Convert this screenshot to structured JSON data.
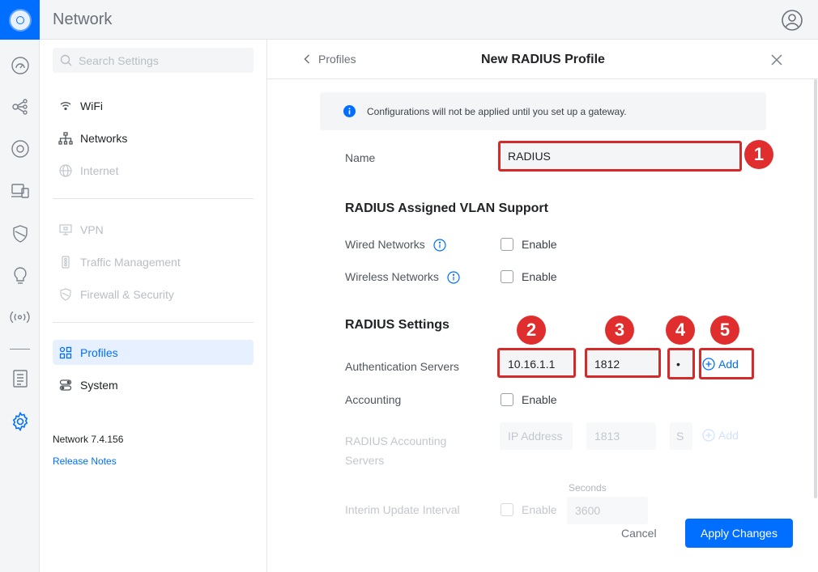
{
  "app": {
    "title": "Network"
  },
  "sidebar": {
    "search_placeholder": "Search Settings",
    "group1": [
      {
        "label": "WiFi",
        "icon": "wifi-icon",
        "enabled": true
      },
      {
        "label": "Networks",
        "icon": "network-tree-icon",
        "enabled": true
      },
      {
        "label": "Internet",
        "icon": "globe-icon",
        "enabled": false
      }
    ],
    "group2": [
      {
        "label": "VPN",
        "icon": "vpn-icon",
        "enabled": false
      },
      {
        "label": "Traffic Management",
        "icon": "traffic-icon",
        "enabled": false
      },
      {
        "label": "Firewall & Security",
        "icon": "shield-icon",
        "enabled": false
      }
    ],
    "group3": [
      {
        "label": "Profiles",
        "icon": "profiles-icon",
        "active": true
      },
      {
        "label": "System",
        "icon": "system-icon",
        "enabled": true
      }
    ],
    "version": "Network 7.4.156",
    "release_notes": "Release Notes"
  },
  "panel": {
    "back_label": "Profiles",
    "title": "New RADIUS Profile",
    "notice": "Configurations will not be applied until you set up a gateway.",
    "name_label": "Name",
    "name_value": "RADIUS",
    "vlan_section": "RADIUS Assigned VLAN Support",
    "wired_label": "Wired Networks",
    "wireless_label": "Wireless Networks",
    "enable_label": "Enable",
    "radius_section": "RADIUS Settings",
    "auth_label": "Authentication Servers",
    "auth_ip": "10.16.1.1",
    "auth_port": "1812",
    "auth_secret": "•",
    "add_label": "Add",
    "accounting_label": "Accounting",
    "acct_servers_label_1": "RADIUS Accounting",
    "acct_servers_label_2": "Servers",
    "acct_ip_placeholder": "IP Address",
    "acct_port": "1813",
    "acct_secret_placeholder": "S",
    "seconds_label": "Seconds",
    "interim_label": "Interim Update Interval",
    "interim_value": "3600",
    "cancel_label": "Cancel",
    "apply_label": "Apply Changes"
  },
  "annotations": [
    "1",
    "2",
    "3",
    "4",
    "5"
  ],
  "colors": {
    "accent": "#006fff",
    "highlight": "#d42a2a",
    "badge": "#e02d2d"
  }
}
